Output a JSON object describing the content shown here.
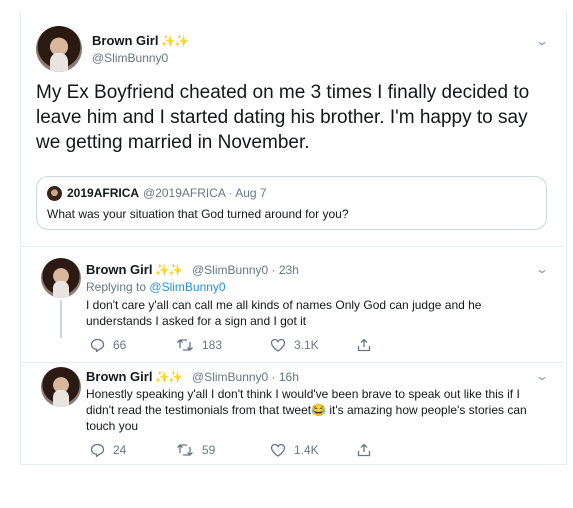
{
  "main": {
    "name": "Brown Girl",
    "handle": "@SlimBunny0",
    "text": "My Ex Boyfriend cheated on me 3 times I finally decided to leave him and I started dating his brother. I'm happy to say we getting married in November."
  },
  "quote": {
    "name": "2019AFRICA",
    "handle": "@2019AFRICA · Aug 7",
    "text": "What was your situation that God turned around for you?"
  },
  "replies": [
    {
      "name": "Brown Girl",
      "handle": "@SlimBunny0 · 23h",
      "replying_prefix": "Replying to",
      "replying_to": "@SlimBunny0",
      "text": "I don't care y'all can call me all kinds of names Only God can judge and he understands I asked for a sign and I got it",
      "replies": "66",
      "retweets": "183",
      "likes": "3.1K"
    },
    {
      "name": "Brown Girl",
      "handle": "@SlimBunny0 · 16h",
      "text": "Honestly speaking y'all I don't think I would've been brave to speak out like this if I didn't read the testimonials from that tweet😂 it's amazing how people's stories can touch you",
      "replies": "24",
      "retweets": "59",
      "likes": "1.4K"
    }
  ],
  "sparkles": "✨✨",
  "colors": {
    "accent": "#1b95e0",
    "muted": "#657786",
    "border": "#e6ecf0"
  },
  "icons": [
    "avatar",
    "sparkle-icon",
    "chevron-down-icon",
    "reply-icon",
    "retweet-icon",
    "like-icon",
    "share-icon"
  ]
}
